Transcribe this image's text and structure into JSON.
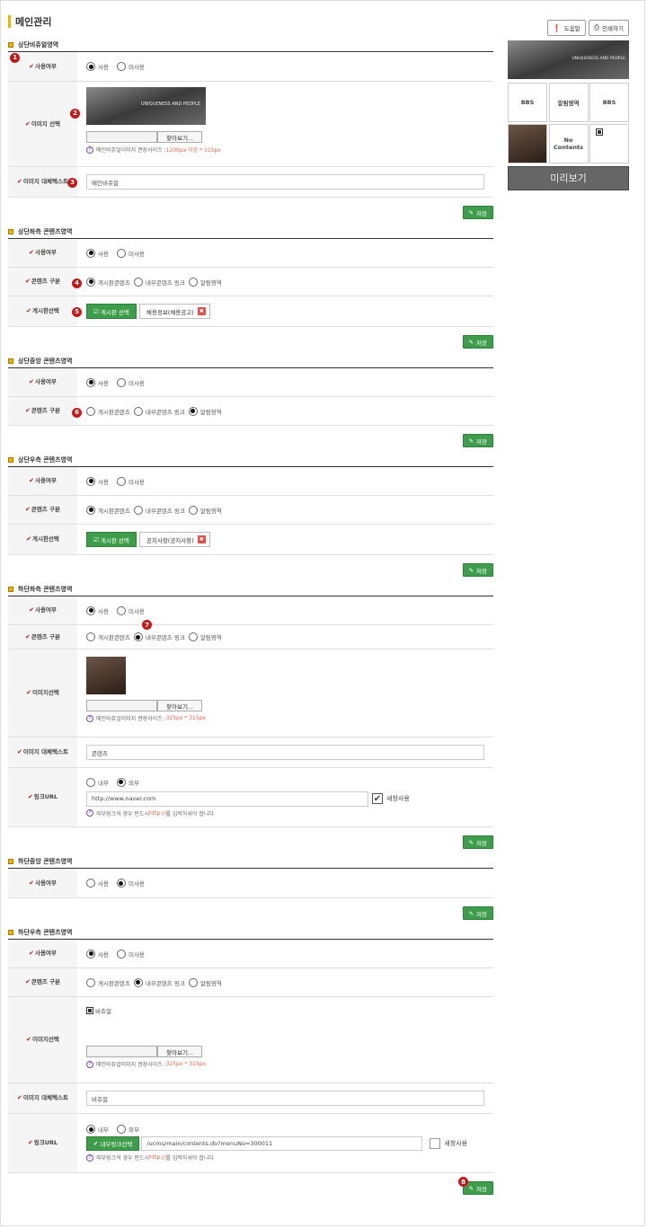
{
  "page_title": "메인관리",
  "toolbar": {
    "help": "도움말",
    "print": "인쇄하기"
  },
  "preview": {
    "row1": [
      "BBS",
      "알림영역",
      "BBS"
    ],
    "no_contents": "No Contents",
    "preview_button": "미리보기",
    "banner_text": "UNIQUENESS AND PEOPLE"
  },
  "common": {
    "use": "사용",
    "unused": "미사용",
    "type_board": "게시판콘텐츠",
    "type_internal": "내부콘텐츠 링크",
    "type_notice": "알림영역",
    "find": "찾아보기...",
    "save": "저장",
    "board_select": "게시판 선택",
    "internal": "내부",
    "external": "외부",
    "new_window": "새창사용",
    "ext_note_pre": "외부링크의 경우 반드시 ",
    "ext_note_url": "http://",
    "ext_note_post": "를 입력하셔야 합니다",
    "internal_link_btn": "내부링크선택",
    "img_note_pre": "메인비쥬얼이미지 권장사이즈 : "
  },
  "labels": {
    "use": "사용여부",
    "image_select1": "이미지 선택",
    "alt_text": "이미지 대체텍스트",
    "content_type": "콘텐츠 구분",
    "board": "게시판선택",
    "image_select2": "이미지선택",
    "link_url": "링크URL"
  },
  "sections": {
    "s1": {
      "title": "상단비쥬얼영역",
      "img_size": "1200px 이상 * 315px",
      "alt_value": "메인비쥬얼"
    },
    "s2": {
      "title": "상단좌측 콘텐츠영역",
      "board_name": "채용정보(채용공고)"
    },
    "s3": {
      "title": "상단중앙 콘텐츠영역"
    },
    "s4": {
      "title": "상단우측 콘텐츠영역",
      "board_name": "공지사항(공지사항)"
    },
    "s5": {
      "title": "하단좌측 콘텐츠영역",
      "img_size": "325px * 315px",
      "alt_value": "콘텐츠",
      "url_value": "http://www.naver.com"
    },
    "s6": {
      "title": "하단중앙 콘텐츠영역"
    },
    "s7": {
      "title": "하단우측 콘텐츠영역",
      "img_label": "비쥬얼",
      "img_size": "325px * 315px",
      "alt_value": "비쥬얼",
      "url_value": "/ucms/main/contents.do?menuNo=300011"
    }
  },
  "badges": [
    "1",
    "2",
    "3",
    "4",
    "5",
    "6",
    "7",
    "8"
  ],
  "colors": {
    "accent": "#f1b400",
    "save_green": "#3e9d4a",
    "badge_red": "#c21a1a"
  }
}
